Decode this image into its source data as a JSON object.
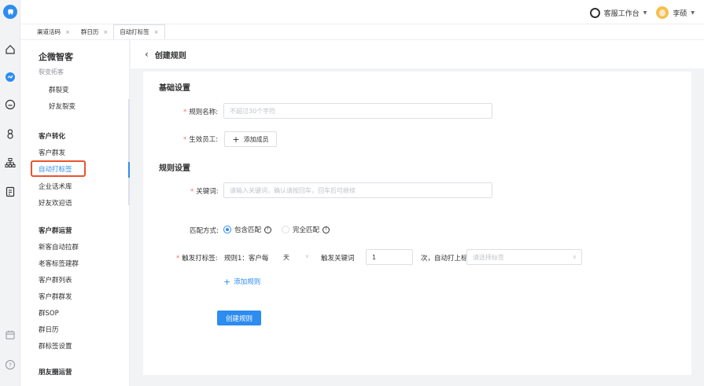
{
  "topbar": {
    "workspace_label": "客服工作台",
    "user_name": "李硕"
  },
  "tabs": [
    {
      "label": "渠道活码",
      "close": "×"
    },
    {
      "label": "群日历",
      "close": "×"
    },
    {
      "label": "自动打标签",
      "close": "×"
    }
  ],
  "menu": {
    "title": "企微智客",
    "items": [
      {
        "label": "裂变拓客"
      },
      {
        "label": "群裂变"
      },
      {
        "label": "好友裂变"
      },
      {
        "label": "客户转化"
      },
      {
        "label": "客户群发"
      },
      {
        "label": "自动打标签"
      },
      {
        "label": "企业话术库"
      },
      {
        "label": "好友欢迎语"
      },
      {
        "label": "客户群运营"
      },
      {
        "label": "新客自动拉群"
      },
      {
        "label": "老客标签建群"
      },
      {
        "label": "客户群列表"
      },
      {
        "label": "客户群群发"
      },
      {
        "label": "群SOP"
      },
      {
        "label": "群日历"
      },
      {
        "label": "群标签设置"
      },
      {
        "label": "朋友圈运营"
      }
    ]
  },
  "page": {
    "back_glyph": "‹",
    "title": "创建规则"
  },
  "form": {
    "basic_section": "基础设置",
    "rule_name_label": "规则名称:",
    "rule_name_placeholder": "不超过30个字符",
    "staff_label": "生效员工:",
    "add_member_label": "添加成员",
    "rule_section": "规则设置",
    "keyword_label": "关键词:",
    "keyword_placeholder": "请输入关键词，确认请按回车，回车后可继续",
    "match_label": "匹配方式:",
    "match_options": [
      {
        "label": "包含匹配",
        "selected": true
      },
      {
        "label": "完全匹配",
        "selected": false
      }
    ],
    "trigger_label": "触发打标签:",
    "rule_prefix": "规则1：客户每",
    "period_value": "天",
    "trigger_keyword_text": "触发关键词",
    "count_value": "1",
    "times_text": "次，自动打上标签",
    "tag_placeholder": "请选择标签",
    "add_rule_label": "添加规则",
    "submit_label": "创建规则"
  },
  "colors": {
    "primary": "#2d8cf0",
    "highlight_border": "#e8542f",
    "required": "#f56c6c"
  }
}
